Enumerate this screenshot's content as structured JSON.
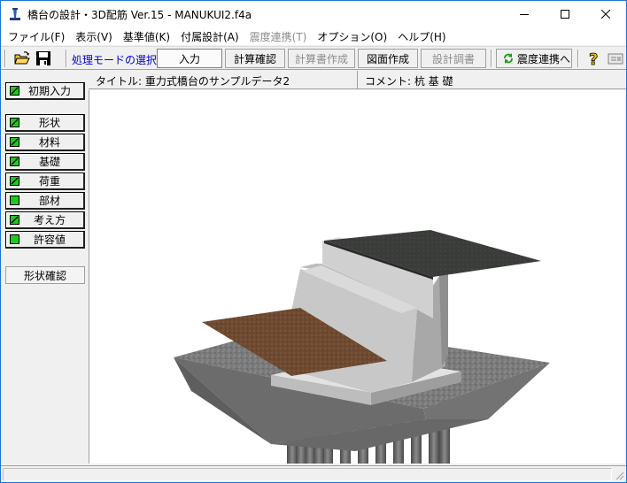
{
  "window": {
    "title": "橋台の設計・3D配筋 Ver.15 - MANUKUI2.f4a",
    "minimize_icon": "minimize-icon",
    "maximize_icon": "maximize-icon",
    "close_icon": "close-icon"
  },
  "menu": [
    {
      "label": "ファイル(F)",
      "enabled": true
    },
    {
      "label": "表示(V)",
      "enabled": true
    },
    {
      "label": "基準値(K)",
      "enabled": true
    },
    {
      "label": "付属設計(A)",
      "enabled": true
    },
    {
      "label": "震度連携(T)",
      "enabled": false
    },
    {
      "label": "オプション(O)",
      "enabled": true
    },
    {
      "label": "ヘルプ(H)",
      "enabled": true
    }
  ],
  "toolbar": {
    "open_icon": "folder-open-icon",
    "save_icon": "floppy-disk-icon",
    "mode_label": "処理モードの選択",
    "input_label": "入力",
    "calc_check_label": "計算確認",
    "calc_report_label": "計算書作成",
    "drawing_label": "図面作成",
    "design_survey_label": "設計調書",
    "seismic_link_label": "震度連携へ",
    "seismic_link_icon": "refresh-arrows-icon",
    "help_icon": "help-question-icon",
    "extra_icon": "card-icon"
  },
  "sidebar": {
    "initial_input": "初期入力",
    "items": [
      {
        "label": "形状",
        "checked": true
      },
      {
        "label": "材料",
        "checked": true
      },
      {
        "label": "基礎",
        "checked": true
      },
      {
        "label": "荷重",
        "checked": true
      },
      {
        "label": "部材",
        "checked": false
      },
      {
        "label": "考え方",
        "checked": true
      },
      {
        "label": "許容値",
        "checked": false
      }
    ],
    "shape_check": "形状確認"
  },
  "info": {
    "title": "タイトル: 重力式橋台のサンプルデータ2",
    "comment": "コメント: 杭 基 礎"
  },
  "colors": {
    "check_green": "#1ec81e",
    "concrete": "#c8c8c8",
    "soil": "#6e4a30",
    "ground": "#7a7a7a",
    "deck": "#3a3c3a",
    "pile": "#6a6a6a"
  }
}
